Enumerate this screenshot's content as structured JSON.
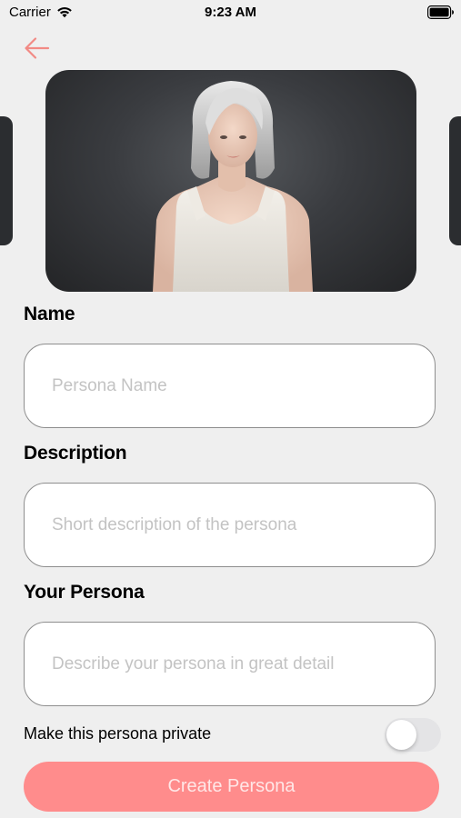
{
  "status_bar": {
    "carrier": "Carrier",
    "time": "9:23 AM",
    "wifi_icon": "wifi-icon",
    "battery_icon": "battery-icon"
  },
  "header": {
    "back_icon": "arrow-left-icon",
    "accent_color": "#ff8c8c"
  },
  "carousel": {
    "selected_index": 1,
    "card_count": 3
  },
  "form": {
    "name": {
      "label": "Name",
      "value": "",
      "placeholder": "Persona Name"
    },
    "description": {
      "label": "Description",
      "value": "",
      "placeholder": "Short description of the persona"
    },
    "persona": {
      "label": "Your Persona",
      "value": "",
      "placeholder": "Describe your persona in great detail"
    },
    "private_toggle": {
      "label": "Make this persona private",
      "checked": false
    }
  },
  "actions": {
    "create_label": "Create Persona",
    "create_color": "#ff8c8c"
  }
}
